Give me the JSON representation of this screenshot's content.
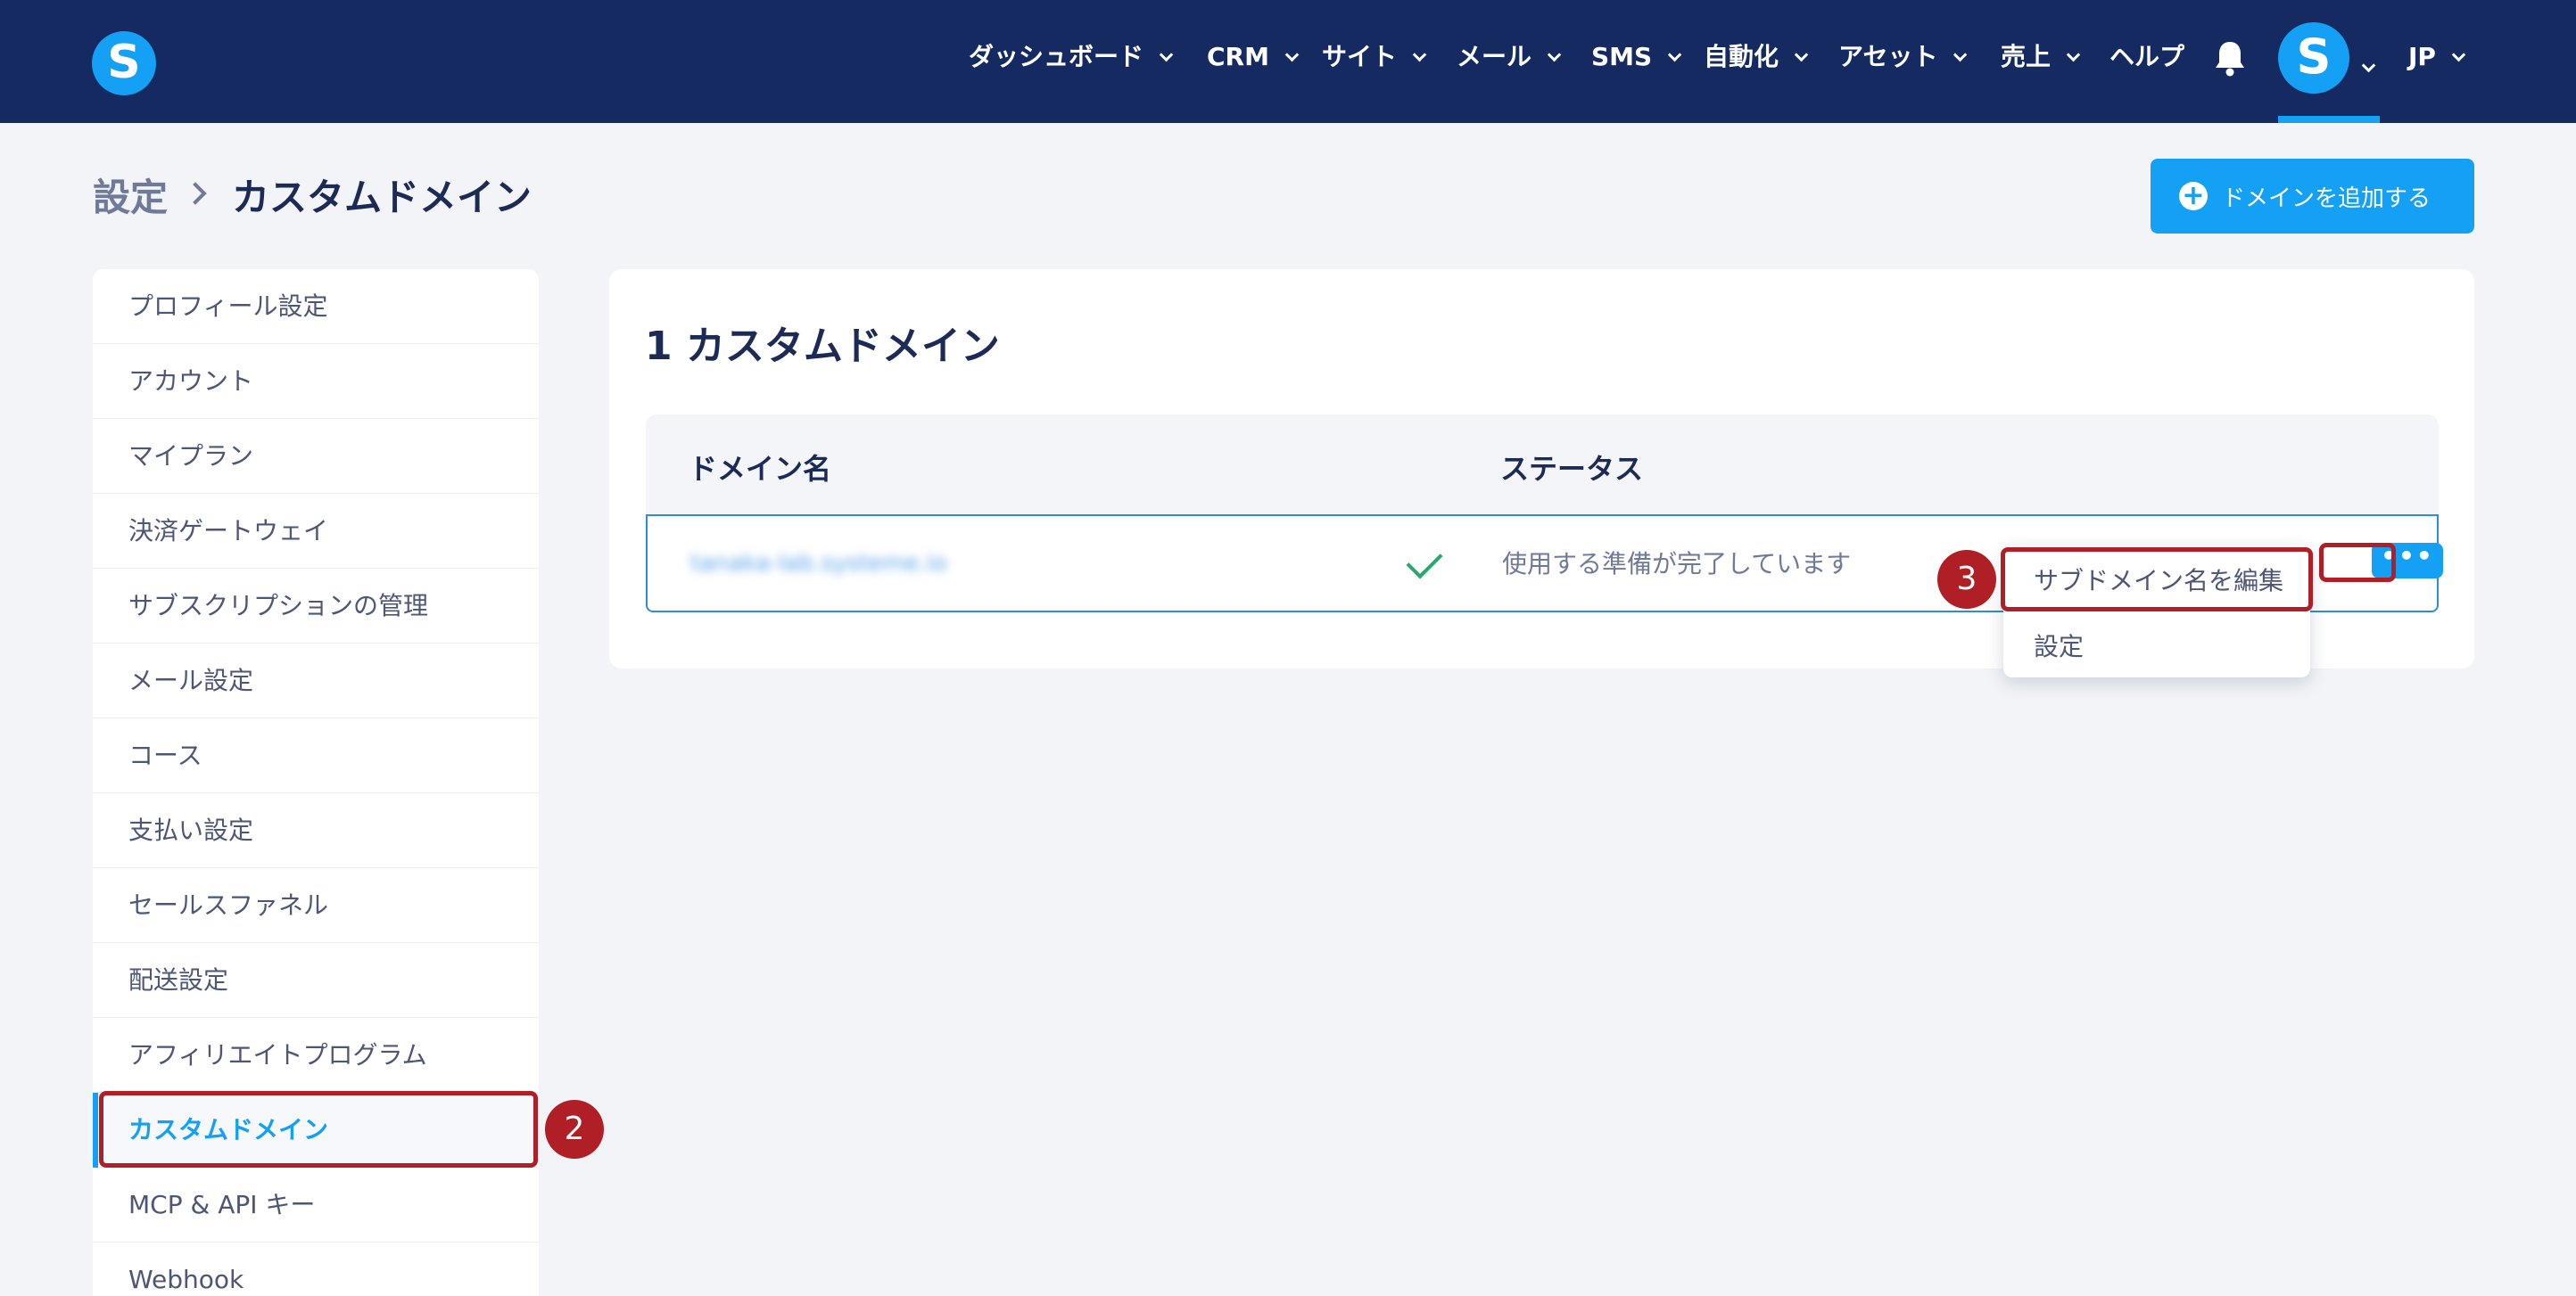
{
  "app": {
    "logo_letter": "S",
    "avatar_letter": "S"
  },
  "nav": {
    "items": [
      "ダッシュボード",
      "CRM",
      "サイト",
      "メール",
      "SMS",
      "自動化",
      "アセット",
      "売上",
      "ヘルプ"
    ],
    "language": "JP"
  },
  "breadcrumb": {
    "root": "設定",
    "current": "カスタムドメイン"
  },
  "add_domain_button": "ドメインを追加する",
  "sidebar": {
    "items": [
      "プロフィール設定",
      "アカウント",
      "マイプラン",
      "決済ゲートウェイ",
      "サブスクリプションの管理",
      "メール設定",
      "コース",
      "支払い設定",
      "セールスファネル",
      "配送設定",
      "アフィリエイトプログラム",
      "カスタムドメイン",
      "MCP & API キー",
      "Webhook"
    ],
    "active_index": 11
  },
  "panel": {
    "title": "1 カスタムドメイン",
    "columns": [
      "ドメイン名",
      "ステータス"
    ],
    "row": {
      "domain": "tanaka-lab.systeme.io",
      "status": "使用する準備が完了しています",
      "more_label": "•••"
    }
  },
  "dropdown": {
    "items": [
      "サブドメイン名を編集",
      "設定"
    ]
  },
  "annotations": {
    "step2": "2",
    "step3": "3"
  },
  "colors": {
    "nav_bg": "#142a60",
    "accent": "#14a1f5",
    "highlight": "#b01f25",
    "success": "#29a86e"
  }
}
